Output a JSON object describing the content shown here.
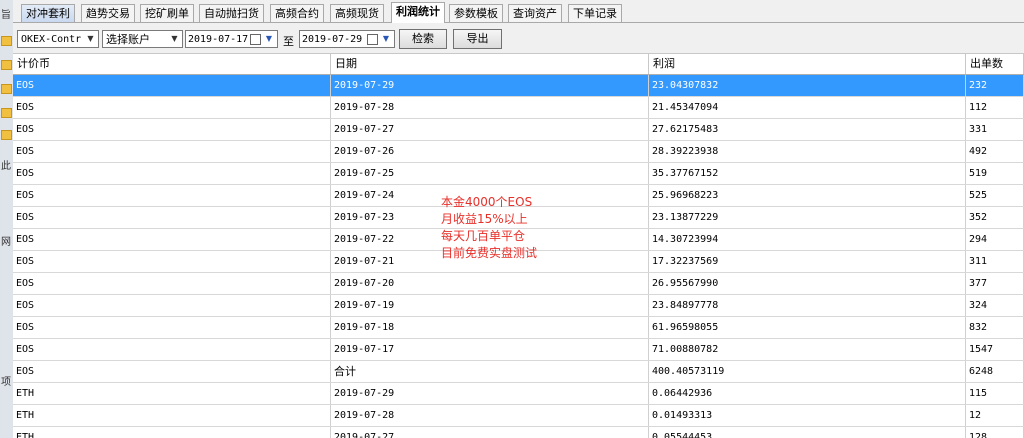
{
  "tabs": [
    "对冲套利",
    "趋势交易",
    "挖矿刷单",
    "自动抛扫货",
    "高频合约",
    "高频现货",
    "利润统计",
    "参数模板",
    "查询资产",
    "下单记录"
  ],
  "active_tab": "利润统计",
  "toolbar": {
    "exchange": "OKEX-Contr",
    "account": "选择账户",
    "date_from": "2019-07-17",
    "to_label": "至",
    "date_to": "2019-07-29",
    "search_label": "检索",
    "export_label": "导出"
  },
  "table": {
    "columns": [
      "计价币",
      "日期",
      "利润",
      "出单数"
    ],
    "rows": [
      [
        "EOS",
        "2019-07-29",
        "23.04307832",
        "232"
      ],
      [
        "EOS",
        "2019-07-28",
        "21.45347094",
        "112"
      ],
      [
        "EOS",
        "2019-07-27",
        "27.62175483",
        "331"
      ],
      [
        "EOS",
        "2019-07-26",
        "28.39223938",
        "492"
      ],
      [
        "EOS",
        "2019-07-25",
        "35.37767152",
        "519"
      ],
      [
        "EOS",
        "2019-07-24",
        "25.96968223",
        "525"
      ],
      [
        "EOS",
        "2019-07-23",
        "23.13877229",
        "352"
      ],
      [
        "EOS",
        "2019-07-22",
        "14.30723994",
        "294"
      ],
      [
        "EOS",
        "2019-07-21",
        "17.32237569",
        "311"
      ],
      [
        "EOS",
        "2019-07-20",
        "26.95567990",
        "377"
      ],
      [
        "EOS",
        "2019-07-19",
        "23.84897778",
        "324"
      ],
      [
        "EOS",
        "2019-07-18",
        "61.96598055",
        "832"
      ],
      [
        "EOS",
        "2019-07-17",
        "71.00880782",
        "1547"
      ],
      [
        "EOS",
        "合计",
        "400.40573119",
        "6248"
      ],
      [
        "ETH",
        "2019-07-29",
        "0.06442936",
        "115"
      ],
      [
        "ETH",
        "2019-07-28",
        "0.01493313",
        "12"
      ],
      [
        "ETH",
        "2019-07-27",
        "0.05544453",
        "128"
      ]
    ],
    "selected_row": 0
  },
  "annotation": [
    "本金4000个EOS",
    "月收益15%以上",
    "每天几百单平仓",
    "目前免费实盘测试"
  ],
  "left_glyphs": [
    "旨",
    "此",
    "网",
    "项"
  ],
  "colors": {
    "selection": "#3399ff",
    "annotation": "#e8302a"
  }
}
